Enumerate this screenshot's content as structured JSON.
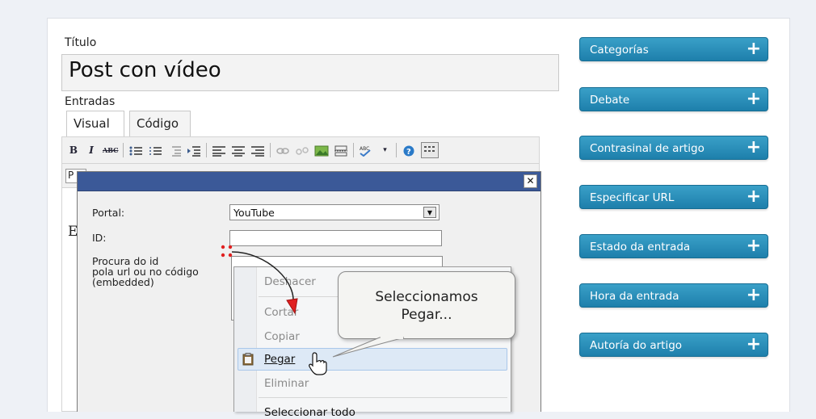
{
  "post": {
    "title_label": "Título",
    "title_value": "Post con vídeo",
    "entries_label": "Entradas",
    "tabs": [
      {
        "label": "Visual"
      },
      {
        "label": "Código"
      }
    ],
    "toolbar": {
      "bold": "B",
      "italic": "I",
      "strike": "ABC"
    },
    "toolbar2_fragment": "P",
    "editor_fragment": "E"
  },
  "dialog": {
    "close_glyph": "✕",
    "portal_label": "Portal:",
    "portal_value": "YouTube",
    "id_label": "ID:",
    "id_value": "",
    "hint_lines": [
      "Procura do id",
      "pola url ou no código",
      "(embedded)"
    ]
  },
  "context_menu": {
    "items": [
      {
        "label": "Deshacer",
        "enabled": false
      },
      {
        "label": "Cortar",
        "enabled": false
      },
      {
        "label": "Copiar",
        "enabled": false
      },
      {
        "label": "Pegar",
        "enabled": true
      },
      {
        "label": "Eliminar",
        "enabled": false
      },
      {
        "label": "Seleccionar todo",
        "enabled": true
      }
    ]
  },
  "callout": {
    "line1": "Seleccionamos",
    "line2": "Pegar..."
  },
  "sidebar": {
    "items": [
      {
        "label": "Categorías"
      },
      {
        "label": "Debate"
      },
      {
        "label": "Contrasinal de artigo"
      },
      {
        "label": "Especificar URL"
      },
      {
        "label": "Estado da entrada"
      },
      {
        "label": "Hora da entrada"
      },
      {
        "label": "Autoría do artigo"
      }
    ],
    "plus_glyph": "+",
    "accent": "#2389b5"
  }
}
